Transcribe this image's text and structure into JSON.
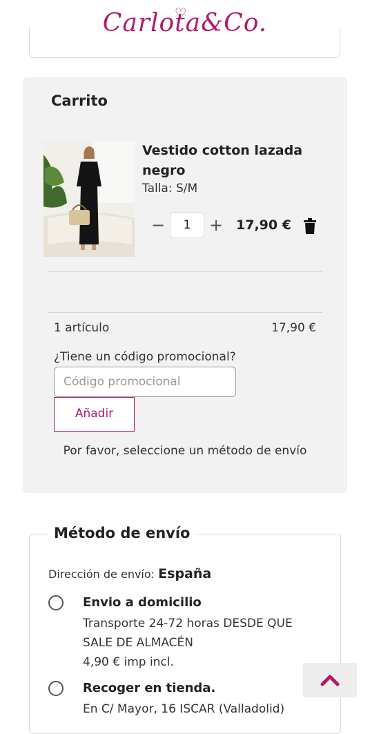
{
  "brand": {
    "logo_text": "Carlota",
    "logo_suffix": "Co.",
    "logo_color": "#b3186e"
  },
  "cart": {
    "title": "Carrito",
    "item": {
      "name": "Vestido cotton lazada negro",
      "size": "Talla: S/M",
      "quantity": "1",
      "price": "17,90 €",
      "icons": {
        "decrease": "minus-icon",
        "increase": "plus-icon",
        "remove": "trash-icon"
      }
    },
    "summary": {
      "count_label": "1 artículo",
      "total": "17,90 €"
    },
    "promo": {
      "question": "¿Tiene un código promocional?",
      "placeholder": "Código promocional",
      "button_label": "Añadir"
    },
    "shipping_note": "Por favor, seleccione un método de envío"
  },
  "shipping": {
    "legend": "Método de envío",
    "address_label": "Dirección de envío:",
    "address_country": "España",
    "options": [
      {
        "title": "Envio a domicilio",
        "description": "Transporte 24-72 horas DESDE QUE SALE DE ALMACÉN",
        "price": "4,90 € imp incl."
      },
      {
        "title": "Recoger en tienda.",
        "description": "En C/ Mayor, 16 ISCAR (Valladolid)"
      }
    ]
  },
  "scroll_top": {
    "icon": "chevron-up-icon"
  },
  "colors": {
    "accent": "#b3186e",
    "panel": "#f2f2f2"
  }
}
